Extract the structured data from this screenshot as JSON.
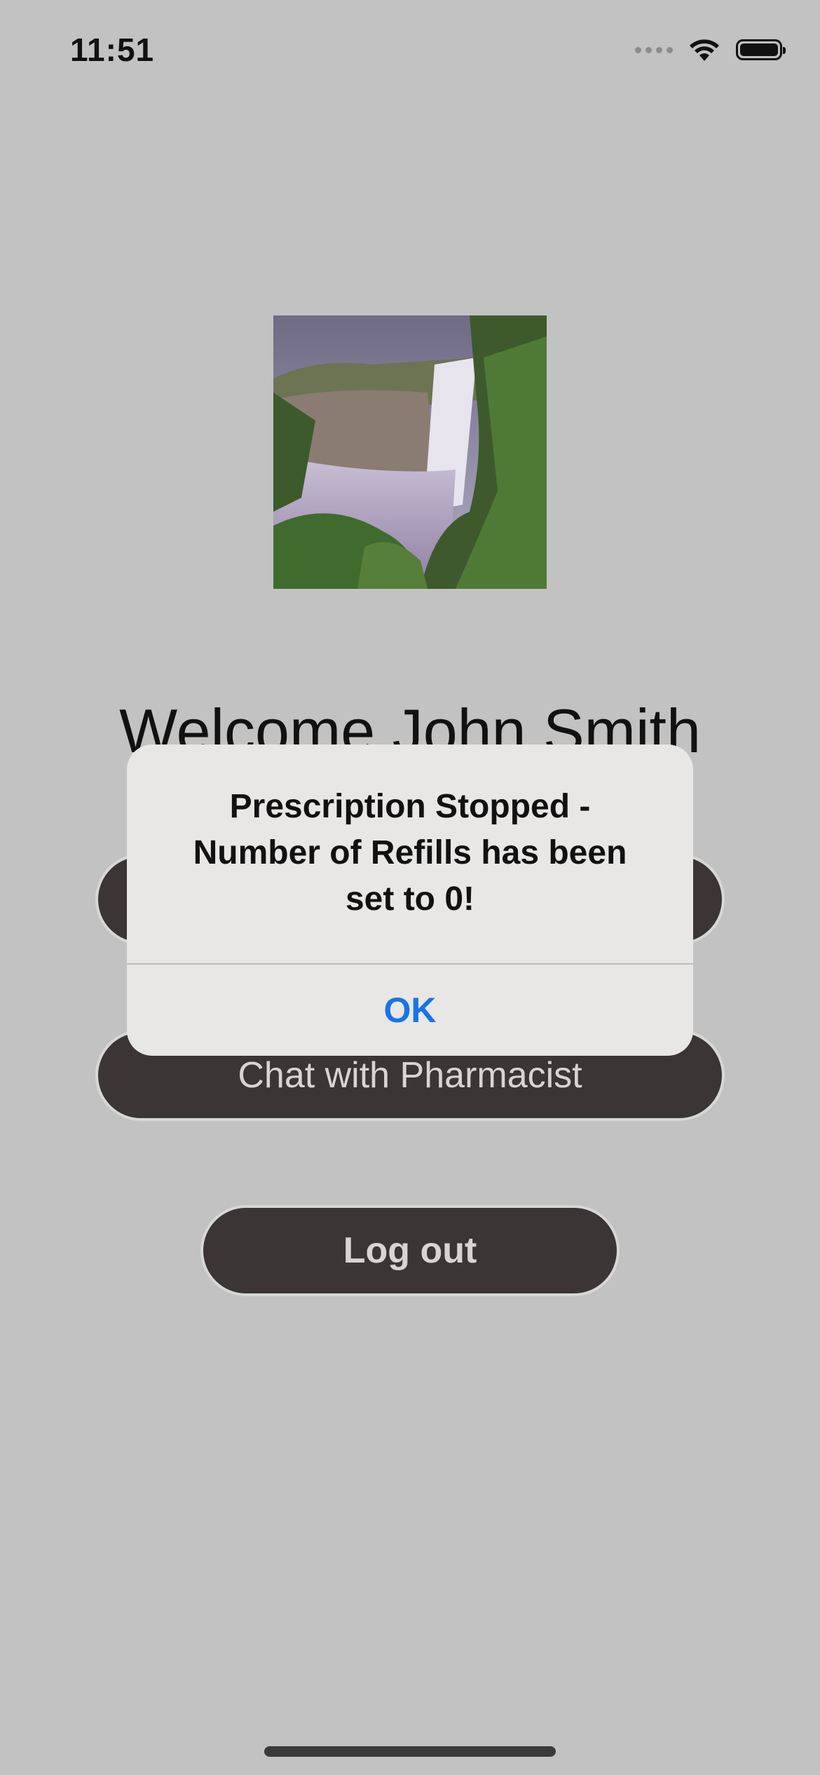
{
  "status_bar": {
    "time": "11:51",
    "icons": [
      "cellular-signal-icon",
      "wifi-icon",
      "battery-icon"
    ]
  },
  "hero_image": {
    "description_name": "waterfall-image"
  },
  "welcome": {
    "text": "Welcome John Smith"
  },
  "buttons": {
    "hidden_label": "",
    "chat": "Chat with Pharmacist",
    "logout": "Log out"
  },
  "alert": {
    "title": "Prescription Stopped - Number of Refills has been set to 0!",
    "ok": "OK",
    "ok_color": "#1a73e8"
  },
  "colors": {
    "background": "#c2c2c2",
    "button": "#3b3535",
    "button_text": "#d9d4d4",
    "alert_bg": "#e8e7e6"
  }
}
